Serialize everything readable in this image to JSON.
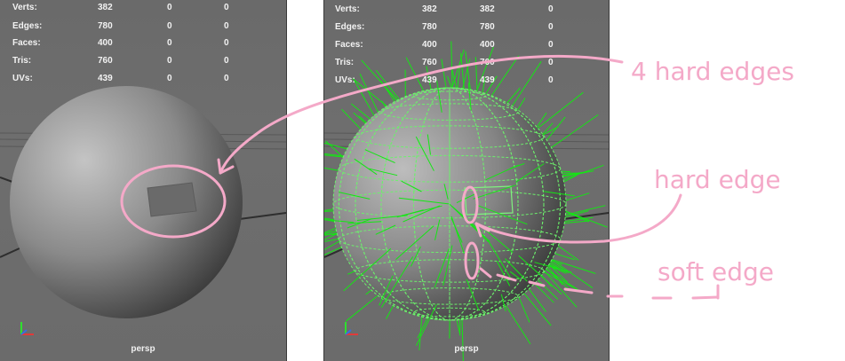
{
  "left_viewport": {
    "stats": [
      {
        "label": "Verts:",
        "v1": "382",
        "v2": "0",
        "v3": "0"
      },
      {
        "label": "Edges:",
        "v1": "780",
        "v2": "0",
        "v3": "0"
      },
      {
        "label": "Faces:",
        "v1": "400",
        "v2": "0",
        "v3": "0"
      },
      {
        "label": "Tris:",
        "v1": "760",
        "v2": "0",
        "v3": "0"
      },
      {
        "label": "UVs:",
        "v1": "439",
        "v2": "0",
        "v3": "0"
      }
    ],
    "camera": "persp"
  },
  "right_viewport": {
    "stats": [
      {
        "label": "Verts:",
        "v1": "382",
        "v2": "382",
        "v3": "0"
      },
      {
        "label": "Edges:",
        "v1": "780",
        "v2": "780",
        "v3": "0"
      },
      {
        "label": "Faces:",
        "v1": "400",
        "v2": "400",
        "v3": "0"
      },
      {
        "label": "Tris:",
        "v1": "760",
        "v2": "760",
        "v3": "0"
      },
      {
        "label": "UVs:",
        "v1": "439",
        "v2": "439",
        "v3": "0"
      }
    ],
    "camera": "persp"
  },
  "annotations": {
    "four_hard_edges": "4 hard edges",
    "hard_edge": "hard edge",
    "soft_edge": "soft edge"
  },
  "colors": {
    "annotation": "#f4a9c8",
    "normals": "#14e614",
    "wireframe": "#6cf06c",
    "viewport_bg": "#6d6d6d"
  }
}
